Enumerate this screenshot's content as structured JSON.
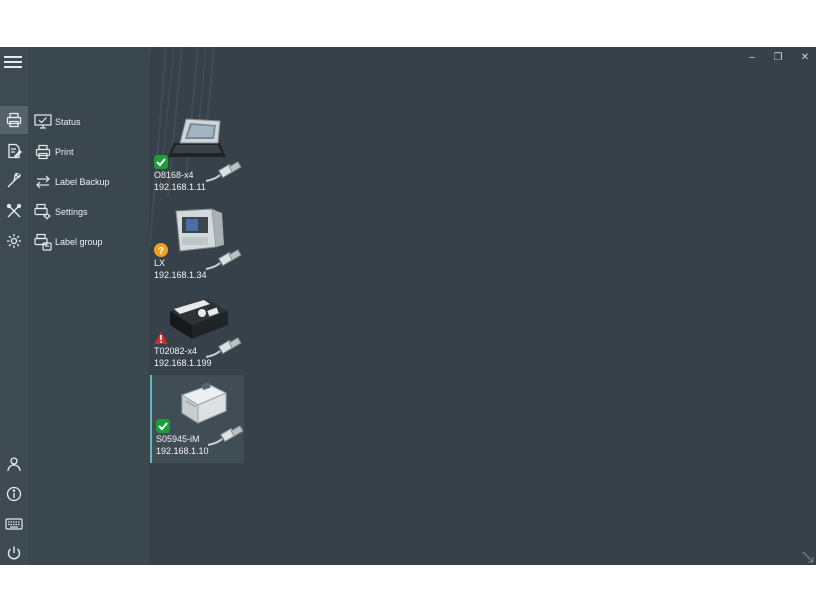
{
  "window": {
    "minimize_glyph": "–",
    "restore_glyph": "❐",
    "close_glyph": "✕"
  },
  "rail_top": [
    {
      "icon": "printer-icon",
      "active": true
    },
    {
      "icon": "label-edit-icon",
      "active": false
    },
    {
      "icon": "wrench-icon",
      "active": false
    },
    {
      "icon": "tools-icon",
      "active": false
    },
    {
      "icon": "gear-icon",
      "active": false
    }
  ],
  "rail_bottom": [
    {
      "icon": "user-icon"
    },
    {
      "icon": "info-icon"
    },
    {
      "icon": "keyboard-icon"
    },
    {
      "icon": "power-icon"
    }
  ],
  "menu": {
    "items": [
      {
        "label": "Status",
        "icon": "monitor-check-icon"
      },
      {
        "label": "Print",
        "icon": "printer-icon"
      },
      {
        "label": "Label Backup",
        "icon": "arrows-swap-icon"
      },
      {
        "label": "Settings",
        "icon": "printer-gear-icon"
      },
      {
        "label": "Label group",
        "icon": "printer-group-icon"
      }
    ]
  },
  "devices": [
    {
      "name": "O8168-x4",
      "ip": "192.168.1.11",
      "status": "ok",
      "status_color": "#1a9e3a",
      "selected": false
    },
    {
      "name": "LX",
      "ip": "192.168.1.34",
      "status": "unknown",
      "status_color": "#f0a020",
      "selected": false
    },
    {
      "name": "T02082-x4",
      "ip": "192.168.1.199",
      "status": "error",
      "status_color": "#d42a2a",
      "selected": false
    },
    {
      "name": "S05945-iM",
      "ip": "192.168.1.10",
      "status": "ok",
      "status_color": "#1a9e3a",
      "selected": true
    }
  ],
  "colors": {
    "background": "#364149",
    "selection_accent": "#63bcb4"
  }
}
